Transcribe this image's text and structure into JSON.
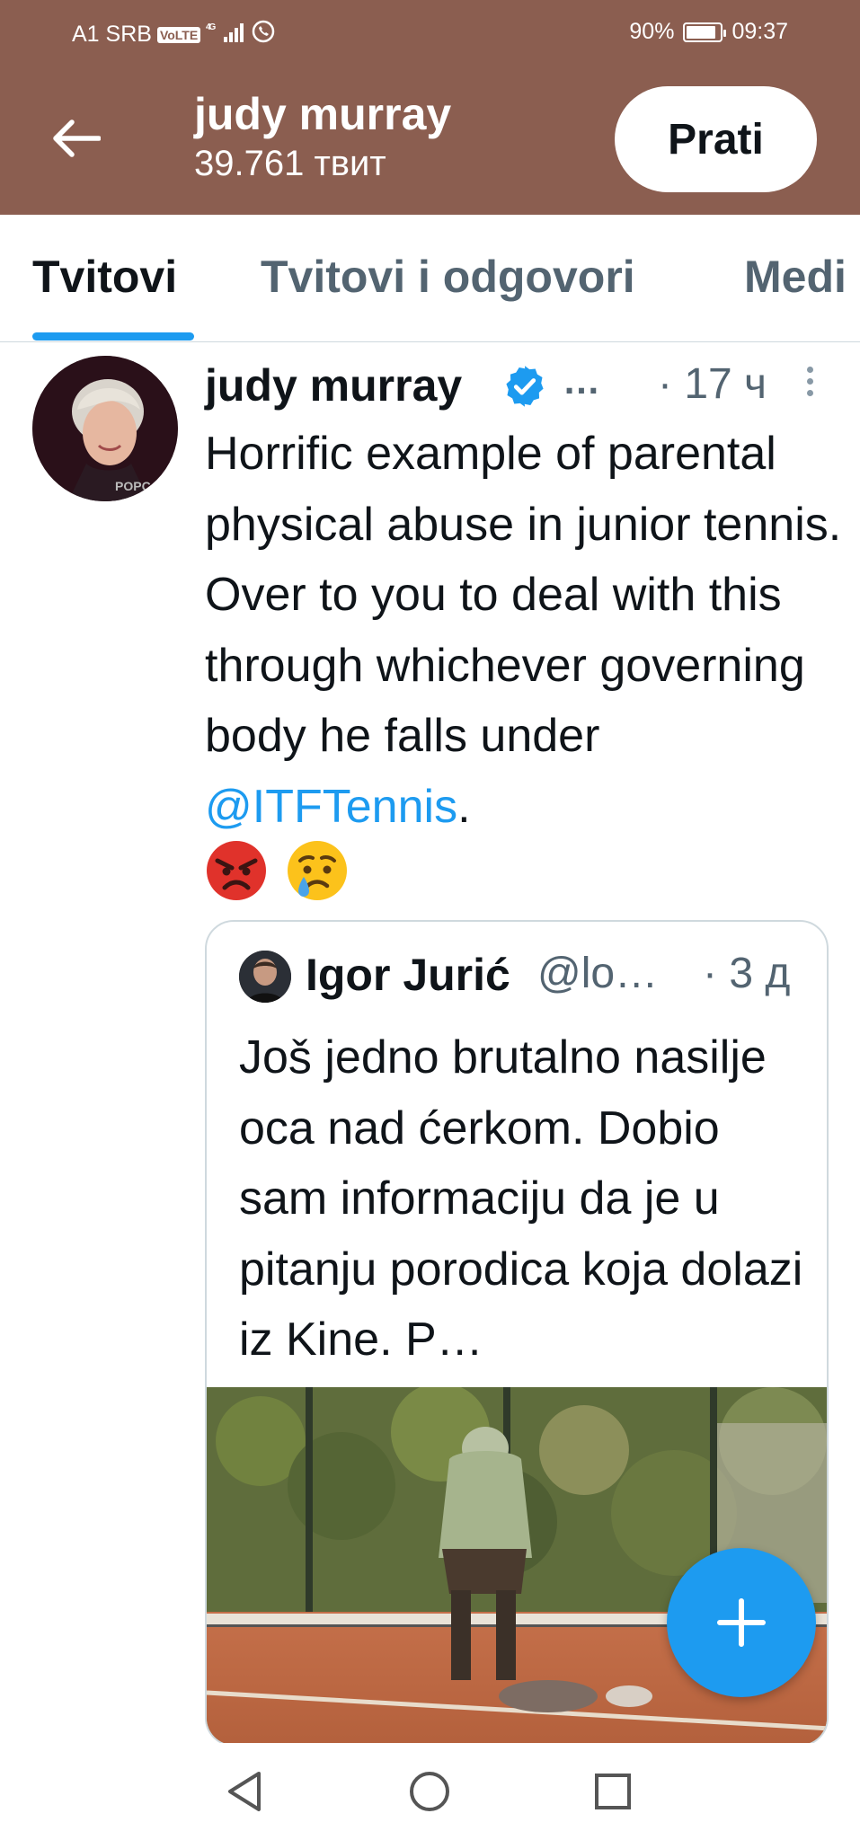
{
  "status_bar": {
    "carrier": "A1 SRB",
    "volte": "VoLTE",
    "network": "4G",
    "battery": "90%",
    "battery_level": 0.9,
    "time": "09:37"
  },
  "header": {
    "back_icon": "arrow-left-icon",
    "name": "judy murray",
    "tweet_count": "39.761 твит",
    "follow_label": "Prati",
    "background_color": "#8b5e50"
  },
  "tabs": [
    {
      "label": "Tvitovi",
      "active": true
    },
    {
      "label": "Tvitovi i odgovori",
      "active": false
    },
    {
      "label": "Medi",
      "active": false
    }
  ],
  "tweet": {
    "author": "judy murray",
    "ellipsis": "…",
    "time": "· 17 ч",
    "text_before_mention": "Horrific example of parental physical abuse in junior tennis. Over to you to deal with this through whichever governing body he falls under ",
    "mention": "@ITFTennis",
    "text_after_mention": ".",
    "emojis": [
      "angry-face-emoji",
      "crying-face-emoji"
    ]
  },
  "quoted_tweet": {
    "author": "Igor Jurić",
    "handle": "@lo…",
    "time": "· 3 д",
    "text": "Još jedno brutalno nasilje oca nad ćerkom. Dobio sam informaciju da je u pitanju porodica koja dolazi iz Kine. P…",
    "media": "tennis-court-video-thumbnail"
  },
  "fab": {
    "icon": "plus-icon"
  },
  "navbar": {
    "back": "triangle-back-icon",
    "home": "circle-home-icon",
    "recent": "square-recent-icon"
  },
  "colors": {
    "accent": "#1d9bf0",
    "text_primary": "#0f1419",
    "text_secondary": "#536471"
  }
}
